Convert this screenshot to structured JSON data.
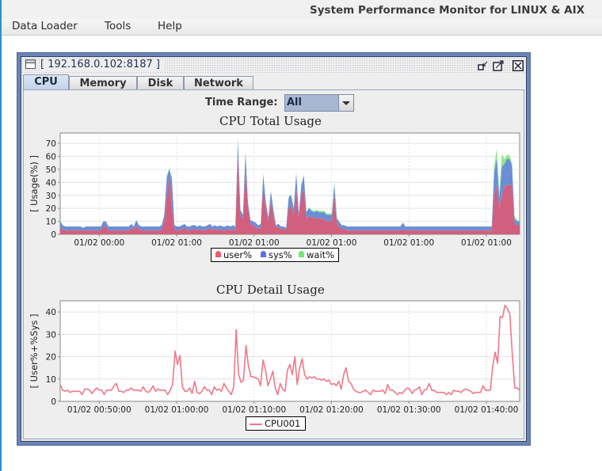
{
  "app": {
    "title": "System Performance Monitor for LINUX & AIX"
  },
  "menu": {
    "items": [
      "Data Loader",
      "Tools",
      "Help"
    ]
  },
  "window": {
    "title": "[ 192.168.0.102:8187 ]",
    "controls": [
      "restore-icon",
      "maximize-icon",
      "close-icon"
    ]
  },
  "tabs": [
    {
      "label": "CPU",
      "active": true
    },
    {
      "label": "Memory",
      "active": false
    },
    {
      "label": "Disk",
      "active": false
    },
    {
      "label": "Network",
      "active": false
    }
  ],
  "time_range": {
    "label": "Time Range:",
    "value": "All"
  },
  "colors": {
    "user": "#d0607e",
    "sys": "#6b8fd4",
    "wait": "#8ee88e",
    "line": "#f07888",
    "window_border": "#6a84b8"
  },
  "chart_data": [
    {
      "type": "area",
      "stacked": true,
      "title": "CPU Total Usage",
      "xlabel": "",
      "ylabel": "[ Usage(%) ]",
      "ylim": [
        0,
        78
      ],
      "yticks": [
        0,
        10,
        20,
        30,
        40,
        50,
        60,
        70
      ],
      "xtick_labels": [
        "01/02 00:00",
        "01/02 01:00",
        "01/02 01:00",
        "01/02 01:00",
        "01/02 01:00",
        "01/02 01:00"
      ],
      "grid": true,
      "legend": "bottom-center",
      "series": [
        {
          "name": "user%",
          "values": [
            5,
            4,
            3,
            3,
            3,
            3,
            3,
            3,
            3,
            3,
            3,
            3,
            3,
            3,
            3,
            3,
            3,
            6,
            6,
            3,
            3,
            3,
            3,
            3,
            3,
            3,
            3,
            3,
            5,
            3,
            7,
            4,
            3,
            3,
            3,
            3,
            3,
            3,
            3,
            3,
            4,
            10,
            30,
            45,
            20,
            4,
            3,
            3,
            4,
            5,
            3,
            3,
            4,
            4,
            3,
            4,
            3,
            3,
            4,
            5,
            3,
            4,
            3,
            4,
            3,
            3,
            4,
            3,
            4,
            3,
            60,
            15,
            12,
            50,
            20,
            8,
            7,
            6,
            4,
            5,
            36,
            20,
            10,
            25,
            15,
            5,
            6,
            4,
            4,
            3,
            20,
            22,
            14,
            35,
            12,
            30,
            35,
            12,
            14,
            13,
            12,
            13,
            12,
            12,
            12,
            10,
            10,
            10,
            30,
            8,
            6,
            4,
            4,
            3,
            3,
            3,
            3,
            3,
            3,
            3,
            3,
            3,
            3,
            3,
            3,
            3,
            3,
            3,
            3,
            3,
            3,
            3,
            3,
            3,
            3,
            4,
            3,
            3,
            3,
            3,
            3,
            3,
            3,
            3,
            3,
            3,
            3,
            3,
            3,
            3,
            3,
            3,
            3,
            3,
            3,
            3,
            3,
            3,
            3,
            3,
            3,
            3,
            3,
            3,
            3,
            3,
            3,
            3,
            3,
            3,
            3,
            30,
            38,
            20,
            30,
            36,
            38,
            38,
            38,
            8,
            7,
            7
          ]
        },
        {
          "name": "sys%",
          "values": [
            5,
            3,
            3,
            3,
            3,
            3,
            3,
            3,
            3,
            2,
            3,
            3,
            3,
            3,
            3,
            3,
            3,
            4,
            4,
            3,
            3,
            3,
            3,
            3,
            3,
            3,
            3,
            3,
            3,
            3,
            4,
            3,
            3,
            3,
            3,
            3,
            3,
            3,
            3,
            3,
            3,
            5,
            14,
            5,
            22,
            3,
            3,
            3,
            3,
            3,
            3,
            3,
            3,
            3,
            3,
            3,
            3,
            3,
            3,
            3,
            3,
            3,
            3,
            3,
            3,
            3,
            3,
            3,
            3,
            3,
            12,
            4,
            3,
            13,
            4,
            3,
            3,
            3,
            3,
            3,
            10,
            5,
            3,
            8,
            4,
            2,
            2,
            2,
            2,
            2,
            8,
            8,
            6,
            12,
            4,
            8,
            10,
            5,
            6,
            5,
            5,
            5,
            5,
            5,
            5,
            5,
            5,
            5,
            8,
            4,
            3,
            3,
            3,
            3,
            3,
            3,
            3,
            3,
            3,
            3,
            3,
            3,
            3,
            3,
            3,
            3,
            3,
            3,
            3,
            3,
            3,
            3,
            3,
            3,
            3,
            5,
            3,
            3,
            3,
            3,
            3,
            3,
            3,
            3,
            3,
            3,
            3,
            3,
            3,
            3,
            3,
            3,
            3,
            3,
            3,
            3,
            3,
            3,
            3,
            3,
            3,
            3,
            3,
            3,
            3,
            3,
            3,
            3,
            3,
            3,
            3,
            18,
            20,
            8,
            22,
            18,
            20,
            20,
            15,
            4,
            3,
            3
          ]
        },
        {
          "name": "wait%",
          "values": [
            1,
            0,
            0,
            0,
            0,
            0,
            0,
            0,
            0,
            0,
            0,
            0,
            0,
            0,
            0,
            0,
            0,
            0,
            0,
            0,
            0,
            0,
            0,
            0,
            0,
            0,
            0,
            0,
            0,
            0,
            0,
            0,
            0,
            0,
            0,
            0,
            0,
            0,
            0,
            0,
            0,
            0,
            1,
            1,
            2,
            0,
            0,
            0,
            0,
            0,
            0,
            0,
            0,
            0,
            0,
            0,
            0,
            0,
            0,
            0,
            0,
            0,
            0,
            0,
            0,
            0,
            0,
            0,
            0,
            0,
            2,
            0,
            0,
            1,
            0,
            0,
            0,
            0,
            0,
            0,
            1,
            0,
            0,
            1,
            0,
            0,
            0,
            0,
            0,
            0,
            1,
            1,
            0,
            1,
            0,
            0,
            1,
            0,
            1,
            1,
            1,
            1,
            1,
            1,
            1,
            1,
            1,
            1,
            3,
            1,
            1,
            0,
            0,
            0,
            0,
            0,
            0,
            0,
            0,
            0,
            0,
            0,
            0,
            0,
            0,
            0,
            0,
            0,
            0,
            0,
            0,
            0,
            0,
            0,
            0,
            0,
            0,
            0,
            0,
            0,
            0,
            0,
            0,
            0,
            0,
            0,
            0,
            0,
            0,
            0,
            0,
            0,
            0,
            0,
            0,
            0,
            0,
            0,
            0,
            0,
            0,
            0,
            0,
            0,
            0,
            0,
            0,
            0,
            0,
            0,
            0,
            5,
            8,
            3,
            10,
            4,
            3,
            3,
            2,
            2,
            1,
            1
          ]
        }
      ]
    },
    {
      "type": "line",
      "title": "CPU Detail Usage",
      "xlabel": "",
      "ylabel": "[ User%+%Sys ]",
      "ylim": [
        0,
        45
      ],
      "yticks": [
        0,
        10,
        20,
        30,
        40
      ],
      "xtick_labels": [
        "01/02 00:50:00",
        "01/02 01:00:00",
        "01/02 01:10:00",
        "01/02 01:20:00",
        "01/02 01:30:00",
        "01/02 01:40:00"
      ],
      "grid": true,
      "legend": "bottom-center",
      "series": [
        {
          "name": "CPU001",
          "values": [
            7.5,
            5,
            4.5,
            5,
            4,
            4.5,
            4.5,
            4.5,
            4.5,
            3,
            5.5,
            5.5,
            5,
            3.5,
            5,
            6,
            5,
            5,
            3,
            5,
            5,
            5,
            7,
            8,
            4.5,
            4.5,
            4,
            5,
            5,
            6,
            5,
            5,
            5,
            4.5,
            6.5,
            4.5,
            4,
            5,
            7,
            4.5,
            5.5,
            5,
            5,
            5,
            3,
            5,
            7.5,
            22.5,
            16.5,
            20.5,
            6.5,
            4.5,
            4.5,
            6,
            3.5,
            9,
            4,
            3.5,
            4.5,
            6.5,
            5,
            5,
            3,
            6.5,
            5,
            5.5,
            4.5,
            8,
            6,
            4.5,
            3,
            6.5,
            32,
            12,
            8.5,
            9.5,
            25,
            16,
            11,
            11,
            10.5,
            10,
            7,
            18.5,
            14,
            7,
            10,
            13.5,
            6,
            3,
            8,
            5.5,
            4.5,
            14,
            16.5,
            12,
            20,
            7.5,
            15,
            19,
            12,
            10,
            11,
            10.5,
            11,
            10,
            10,
            9.5,
            10,
            9,
            9.5,
            7.5,
            8,
            7,
            9,
            5.5,
            12,
            15,
            9,
            8,
            5.5,
            4.5,
            4,
            4,
            4.5,
            5,
            4,
            3,
            5,
            4.5,
            4.5,
            4.5,
            5,
            3.5,
            7.5,
            5,
            5,
            4,
            3,
            4,
            3.5,
            5,
            6,
            5.5,
            3.5,
            5,
            5.5,
            6.5,
            3,
            5,
            5.5,
            8,
            5,
            5,
            4,
            4,
            4,
            4,
            3,
            4,
            3,
            5,
            4.5,
            4.5,
            4,
            5,
            5.5,
            5,
            4.5,
            3.5,
            4,
            4,
            4,
            7,
            5,
            5,
            5,
            16,
            22,
            17,
            38,
            37.5,
            43,
            41.5,
            39,
            21,
            6,
            6,
            5
          ]
        }
      ]
    }
  ]
}
